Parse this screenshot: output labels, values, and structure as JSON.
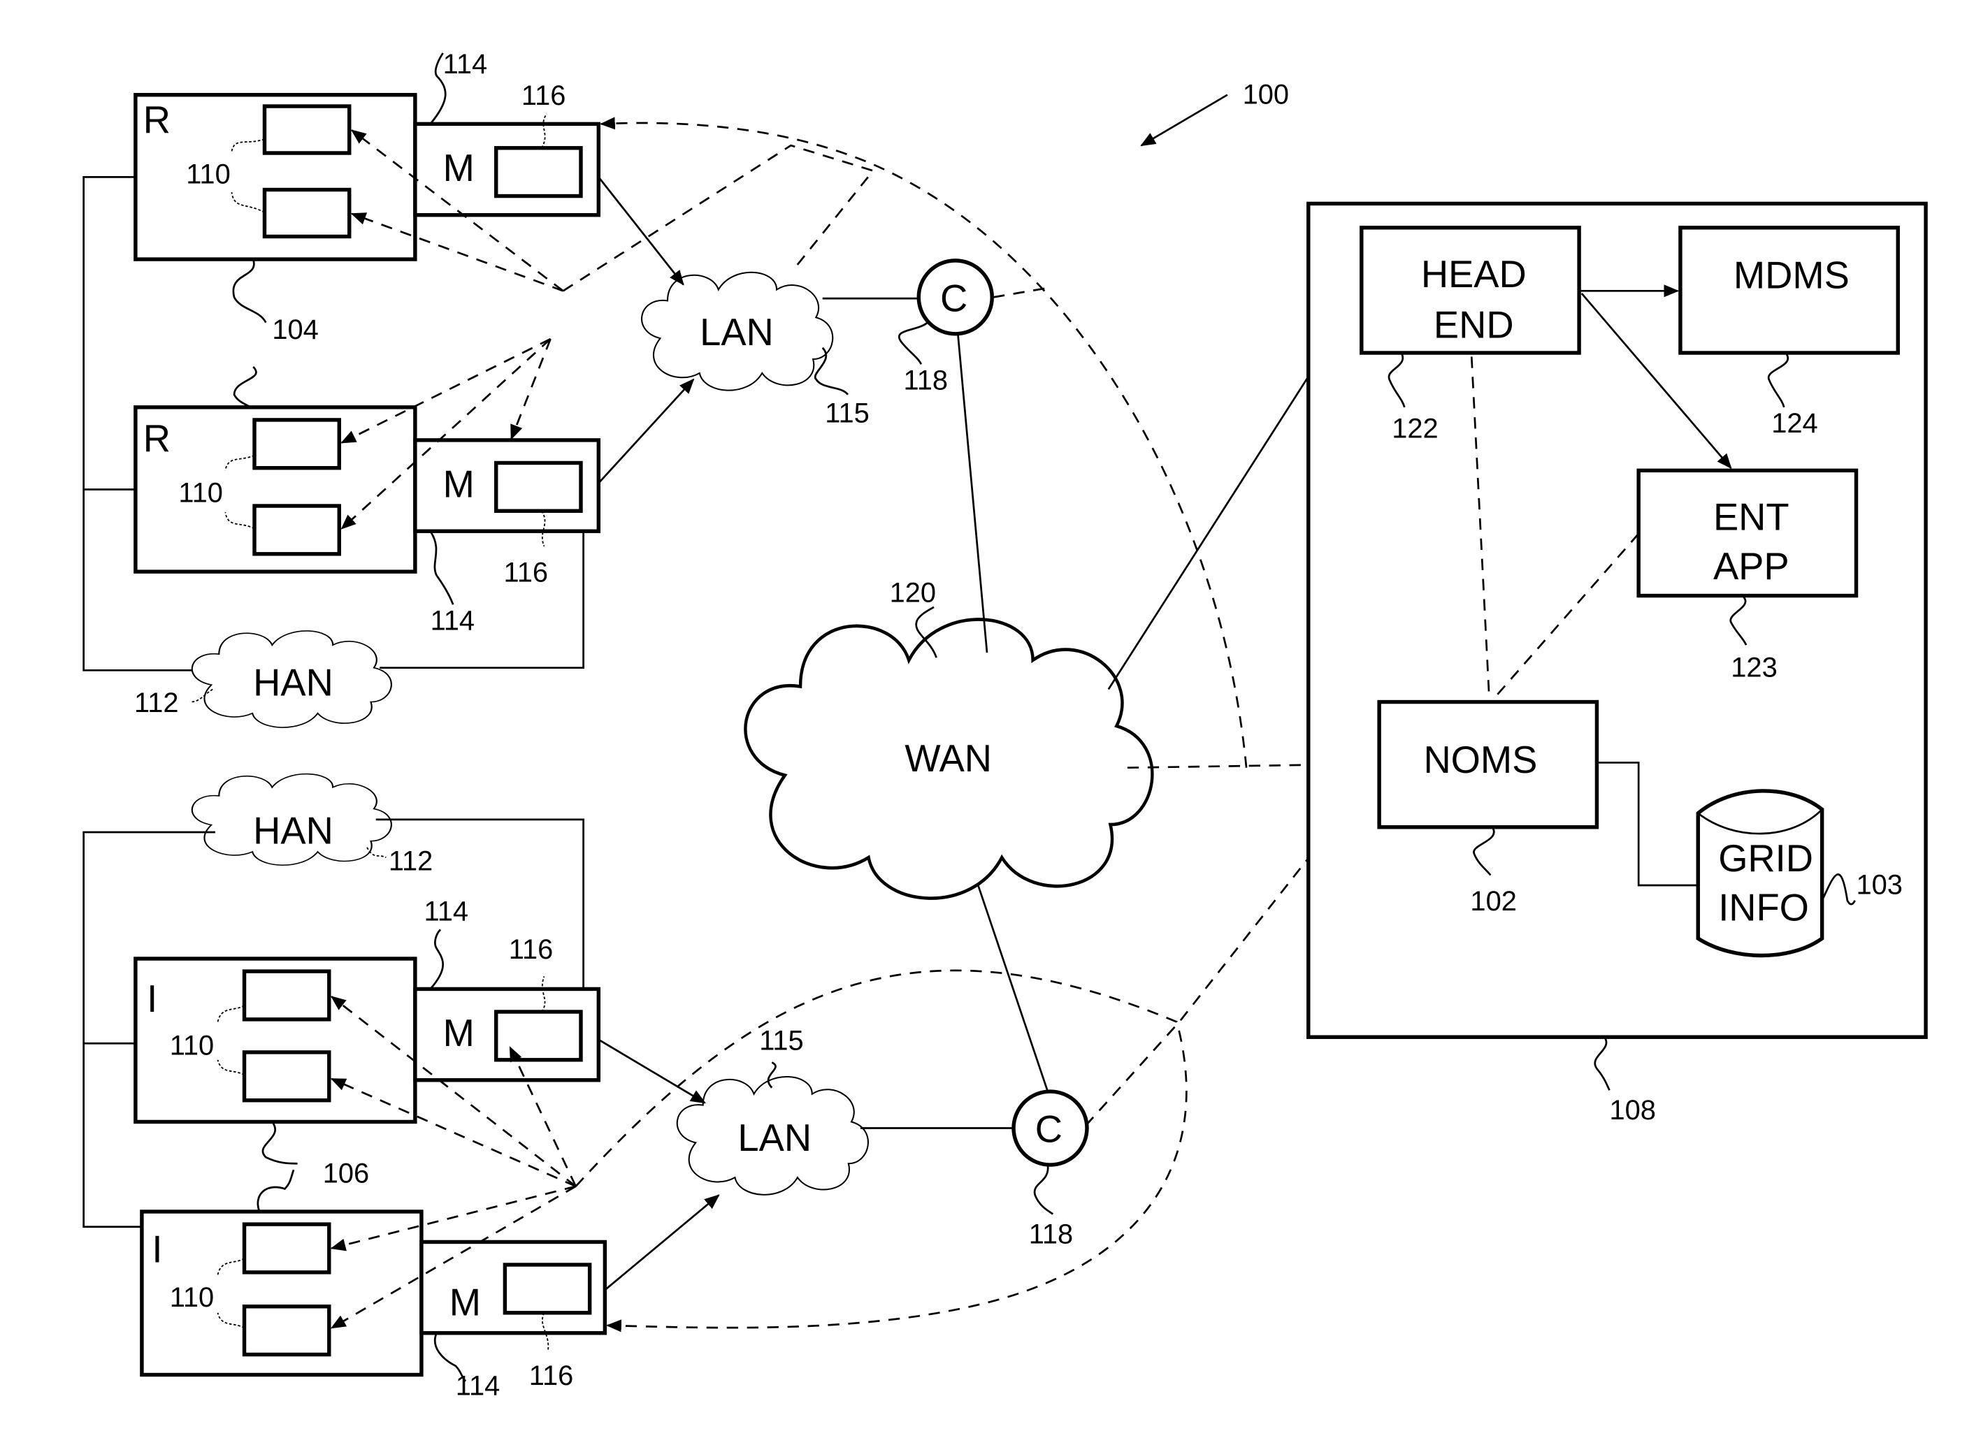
{
  "figure": {
    "reference": "100",
    "premises": [
      {
        "type_label": "R",
        "ref": "104",
        "meter_label": "M",
        "meter_ref": "114",
        "module_ref": "116",
        "device_ref": "110"
      },
      {
        "type_label": "R",
        "ref": "104",
        "meter_label": "M",
        "meter_ref": "114",
        "module_ref": "116",
        "device_ref": "110"
      },
      {
        "type_label": "I",
        "ref": "106",
        "meter_label": "M",
        "meter_ref": "114",
        "module_ref": "116",
        "device_ref": "110"
      },
      {
        "type_label": "I",
        "ref": "106",
        "meter_label": "M",
        "meter_ref": "114",
        "module_ref": "116",
        "device_ref": "110"
      }
    ],
    "han": [
      {
        "label": "HAN",
        "ref": "112"
      },
      {
        "label": "HAN",
        "ref": "112"
      }
    ],
    "lan": [
      {
        "label": "LAN",
        "ref": "115"
      },
      {
        "label": "LAN",
        "ref": "115"
      }
    ],
    "collectors": [
      {
        "label": "C",
        "ref": "118"
      },
      {
        "label": "C",
        "ref": "118"
      }
    ],
    "wan": {
      "label": "WAN",
      "ref": "120"
    },
    "utility": {
      "ref": "108",
      "head_end": {
        "line1": "HEAD",
        "line2": "END",
        "ref": "122"
      },
      "mdms": {
        "label": "MDMS",
        "ref": "124"
      },
      "ent_app": {
        "line1": "ENT",
        "line2": "APP",
        "ref": "123"
      },
      "noms": {
        "label": "NOMS",
        "ref": "102"
      },
      "grid_info": {
        "line1": "GRID",
        "line2": "INFO",
        "ref": "103"
      }
    }
  }
}
